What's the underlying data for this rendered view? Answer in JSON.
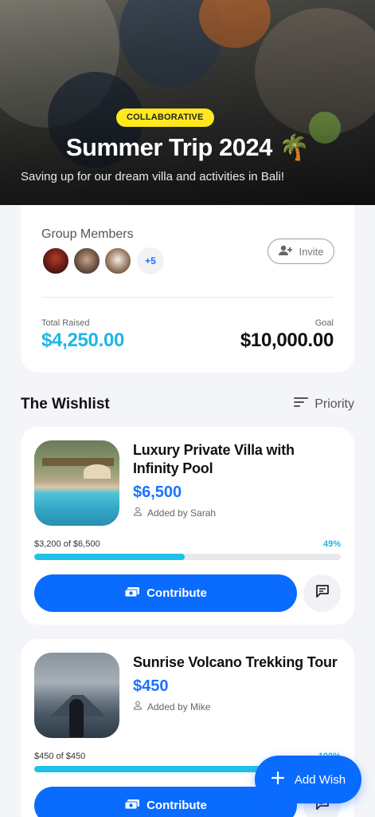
{
  "hero": {
    "badge": "COLLABORATIVE",
    "title": "Summer Trip 2024 🌴",
    "subtitle": "Saving up for our dream villa and activities in Bali!"
  },
  "group": {
    "label": "Group Members",
    "more_count": "+5",
    "invite_label": "Invite",
    "total_raised_label": "Total Raised",
    "total_raised": "$4,250.00",
    "goal_label": "Goal",
    "goal": "$10,000.00"
  },
  "wishlist": {
    "title": "The Wishlist",
    "sort_label": "Priority",
    "items": [
      {
        "name": "Luxury Private Villa with Infinity Pool",
        "price": "$6,500",
        "added_by": "Added by Sarah",
        "progress_text": "$3,200 of $6,500",
        "progress_percent_label": "49%",
        "progress": 0.49,
        "contribute_label": "Contribute"
      },
      {
        "name": "Sunrise Volcano Trekking Tour",
        "price": "$450",
        "added_by": "Added by Mike",
        "progress_text": "$450 of $450",
        "progress_percent_label": "100%",
        "progress": 1.0,
        "contribute_label": "Contribute"
      }
    ]
  },
  "fab": {
    "label": "Add Wish"
  },
  "colors": {
    "accent": "#0a6bff",
    "progress": "#1fc2e8",
    "badge": "#ffe81f",
    "raised": "#1fb6e6"
  }
}
